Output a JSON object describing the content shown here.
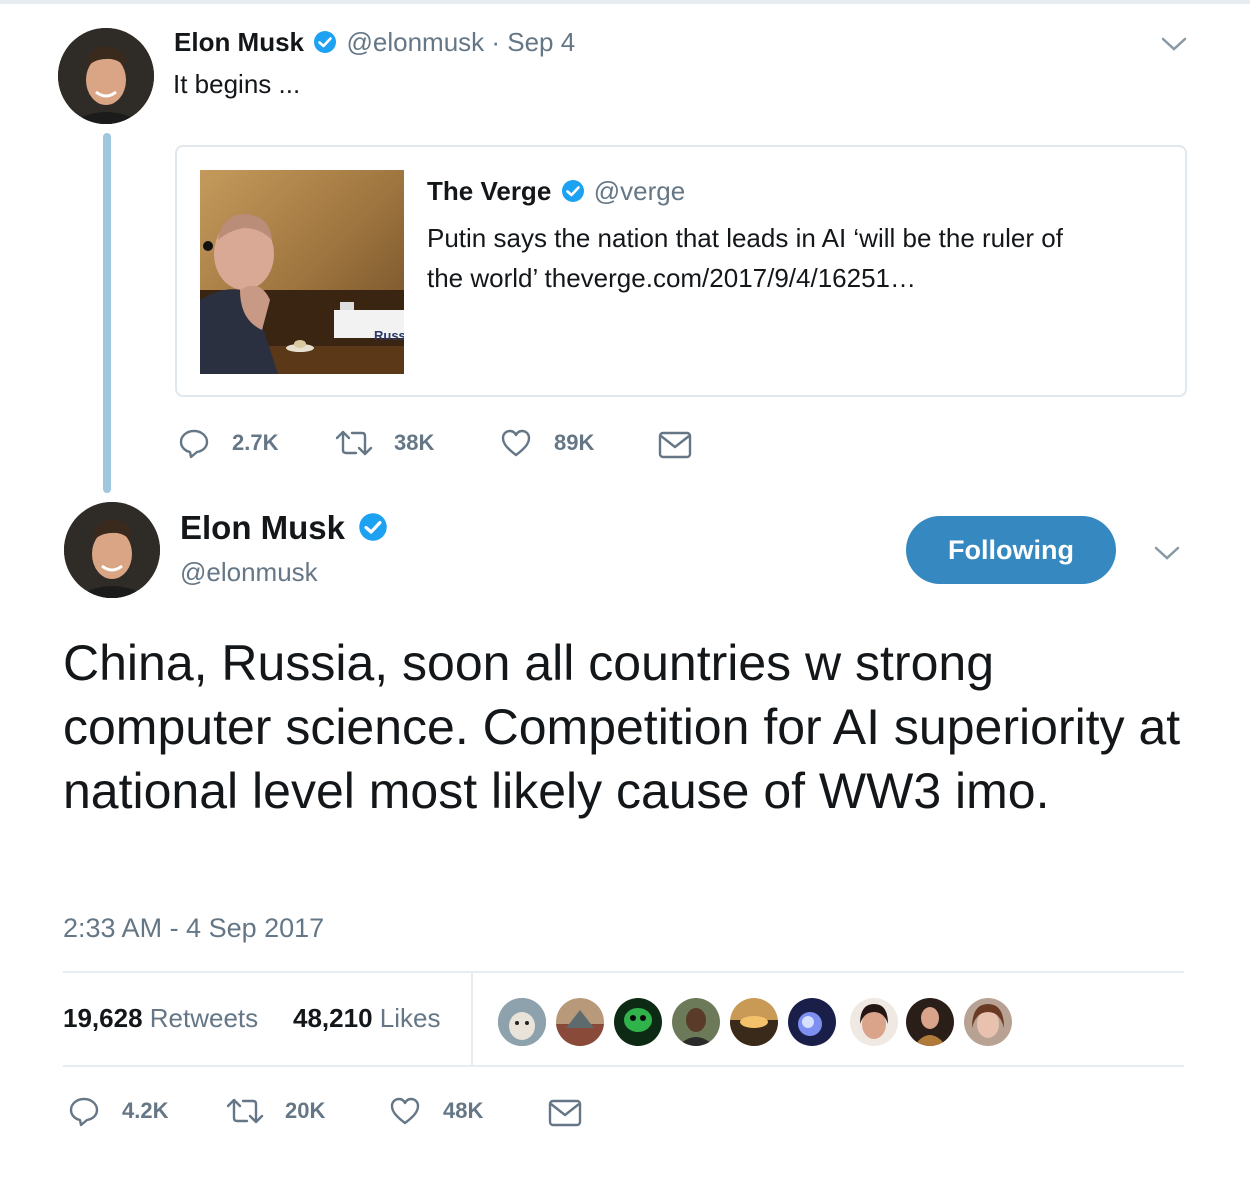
{
  "parent_tweet": {
    "author_name": "Elon Musk",
    "handle_date": "@elonmusk · Sep 4",
    "text": "It begins ...",
    "quoted": {
      "author_name": "The Verge",
      "handle": "@verge",
      "text_line1": "Putin says the nation that leads in AI ‘will be the ruler of",
      "text_line2": "the world’ theverge.com/2017/9/4/16251…",
      "image_sign_text": "Russ"
    },
    "actions": {
      "replies": "2.7K",
      "retweets": "38K",
      "likes": "89K"
    }
  },
  "main_tweet": {
    "author_name": "Elon Musk",
    "handle": "@elonmusk",
    "follow_button": "Following",
    "text": "China, Russia, soon all countries w strong computer science. Competition for AI superiority at national level most likely cause of WW3 imo.",
    "timestamp": "2:33 AM - 4 Sep 2017",
    "stats": {
      "retweets_count": "19,628",
      "retweets_label": "Retweets",
      "likes_count": "48,210",
      "likes_label": "Likes"
    },
    "actions": {
      "replies": "4.2K",
      "retweets": "20K",
      "likes": "48K"
    }
  },
  "colors": {
    "verified_blue": "#1da1f2",
    "following_blue": "#3589c0",
    "thread_line": "#9fc8de",
    "muted_gray": "#657786"
  }
}
